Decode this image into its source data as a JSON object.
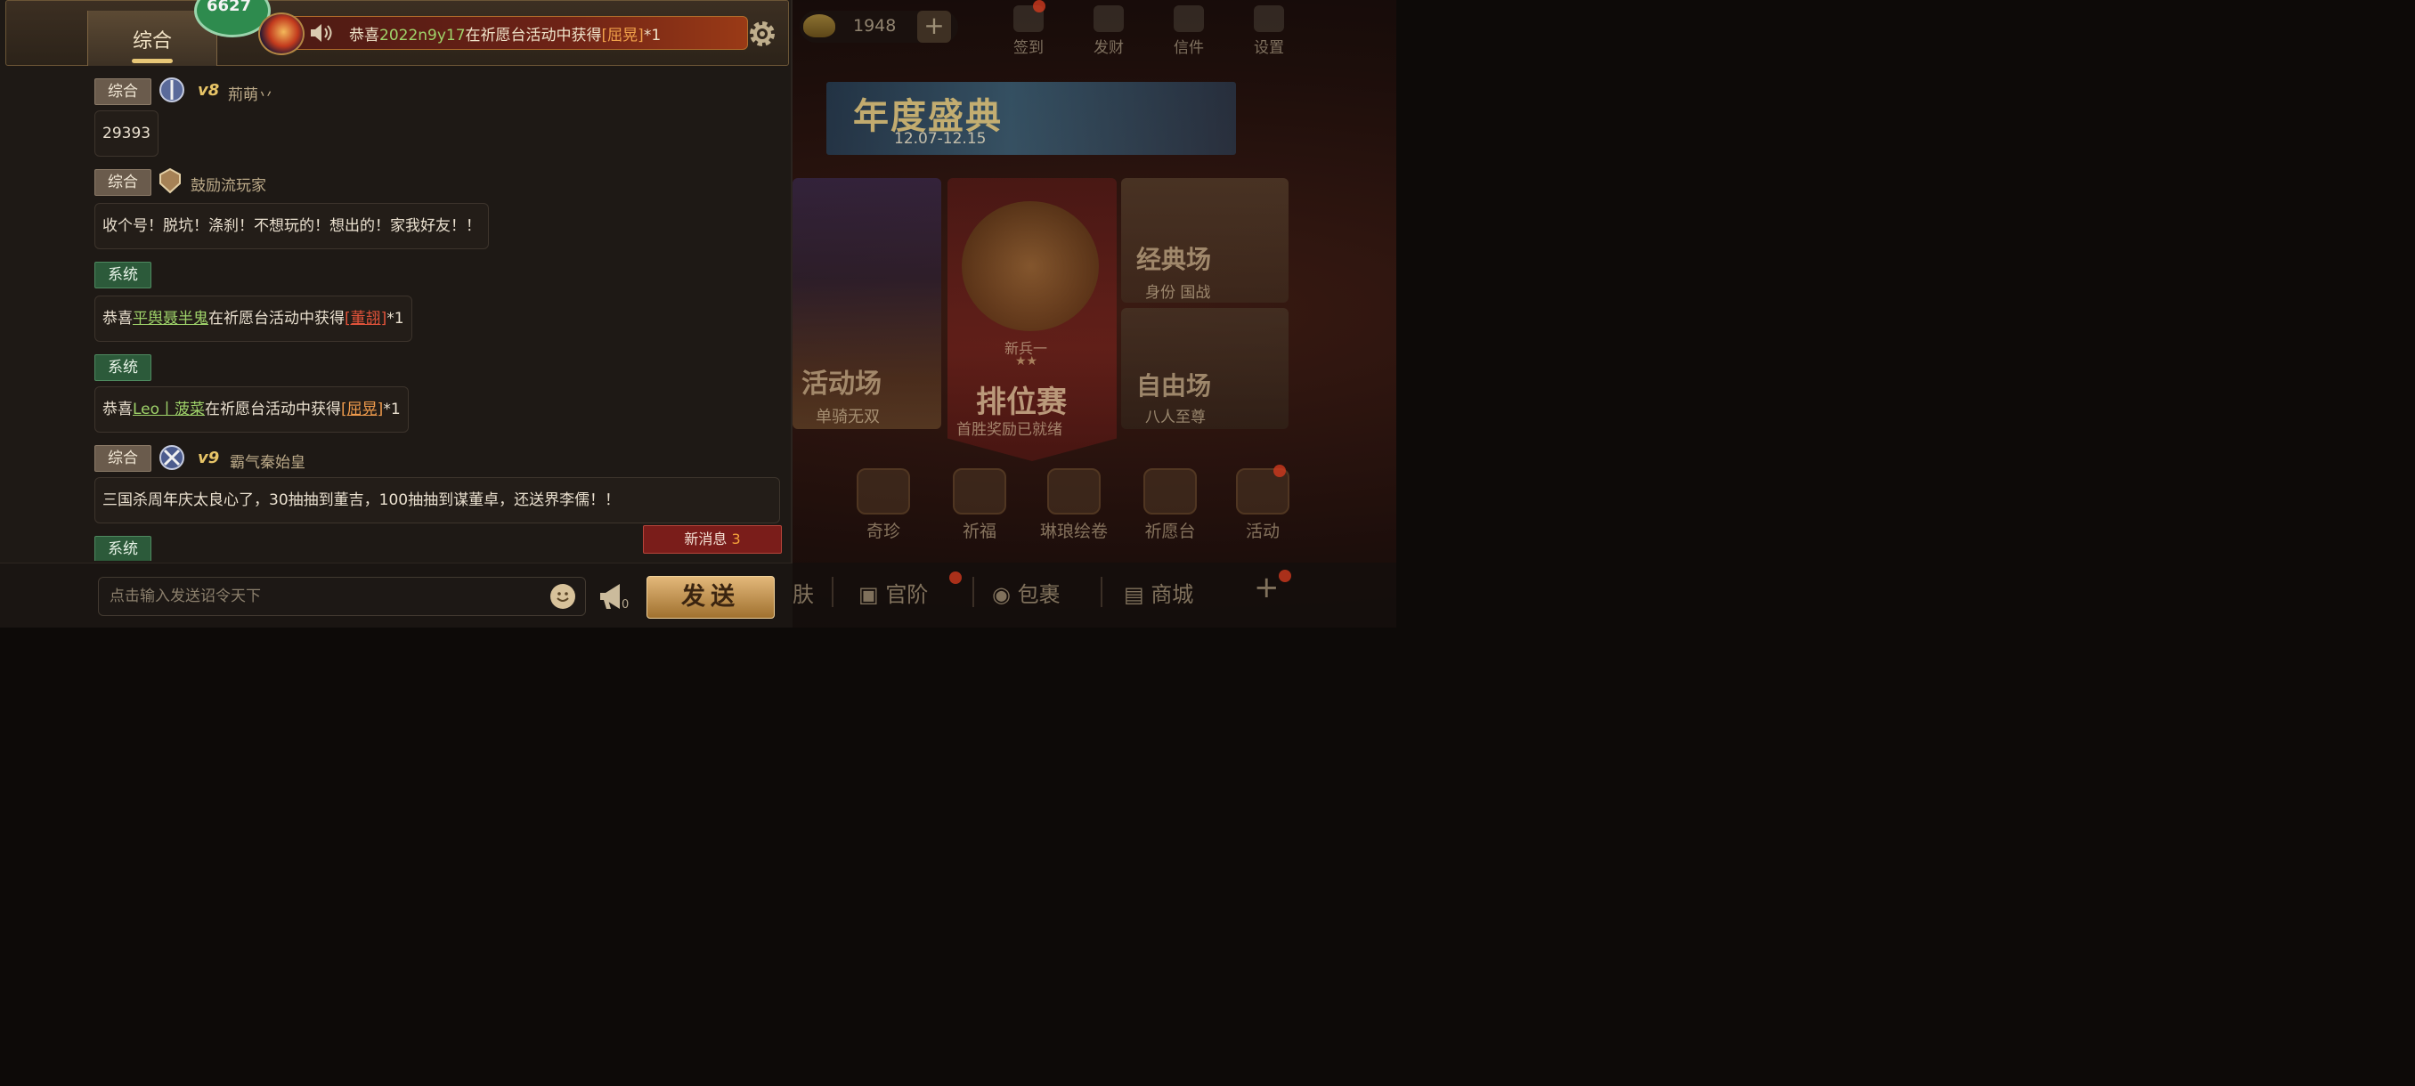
{
  "background": {
    "currency_value": "1948",
    "plus_label": "+",
    "topbar": [
      {
        "label": "签到",
        "icon": "gift-icon"
      },
      {
        "label": "发财",
        "icon": "tree-icon"
      },
      {
        "label": "信件",
        "icon": "mail-icon"
      },
      {
        "label": "设置",
        "icon": "gear-icon"
      }
    ],
    "banner": {
      "title": "年度盛典",
      "date": "12.07-12.15"
    },
    "cards": {
      "event": {
        "title": "活动场",
        "subtitle": "单骑无双"
      },
      "ranked": {
        "rank": "新兵一",
        "stars": "★★",
        "title": "排位赛",
        "subtitle": "首胜奖励已就绪"
      },
      "classic": {
        "title": "经典场",
        "subtitle": "身份  国战"
      },
      "free": {
        "title": "自由场",
        "subtitle": "八人至尊"
      }
    },
    "icon_row": [
      {
        "label": "奇珍",
        "icon": "treasure-icon"
      },
      {
        "label": "祈福",
        "icon": "scroll-icon"
      },
      {
        "label": "琳琅绘卷",
        "icon": "book-icon"
      },
      {
        "label": "祈愿台",
        "icon": "altar-icon"
      },
      {
        "label": "活动",
        "icon": "lantern-icon"
      }
    ],
    "bottom_nav": [
      {
        "label": "肤"
      },
      {
        "label": "官阶"
      },
      {
        "label": "包裹"
      },
      {
        "label": "商城"
      },
      {
        "label": "+"
      }
    ]
  },
  "chat": {
    "tab_label": "综合",
    "badge_text": "6627",
    "ticker": {
      "prefix": "恭喜",
      "player": "2022n9y17",
      "middle": "在祈愿台活动中获得",
      "item": "[屈晃]",
      "suffix": "*1"
    },
    "messages": [
      {
        "channel": "综合",
        "channel_type": "general",
        "vip": "v8",
        "username": "荊萌丷",
        "text": "29393"
      },
      {
        "channel": "综合",
        "channel_type": "general",
        "vip": "",
        "username": "鼓励流玩家",
        "text": "收个号！脱坑！涤刹！不想玩的！想出的！家我好友！！"
      },
      {
        "channel": "系统",
        "channel_type": "system",
        "prefix": "恭喜",
        "player": "平舆聂半鬼",
        "middle": "在祈愿台活动中获得",
        "item": "[董翓]",
        "suffix": "*1"
      },
      {
        "channel": "系统",
        "channel_type": "system",
        "prefix": "恭喜",
        "player": "Leo丨菠菜",
        "middle": "在祈愿台活动中获得",
        "item": "[屈晃]",
        "suffix": "*1"
      },
      {
        "channel": "综合",
        "channel_type": "general",
        "vip": "v9",
        "username": "霸气秦始皇",
        "text": "三国杀周年庆太良心了，30抽抽到董吉，100抽抽到谋董卓，还送界李儒！！"
      },
      {
        "channel": "系统",
        "channel_type": "system"
      }
    ],
    "new_messages": {
      "label": "新消息",
      "count": "3"
    },
    "input_placeholder": "点击输入发送诏令天下",
    "horn_count": "0",
    "send_label": "发送"
  },
  "colors": {
    "accent_gold": "#e7c467",
    "system_green": "#2c5a3a",
    "alert_red": "#7a1d1a"
  }
}
